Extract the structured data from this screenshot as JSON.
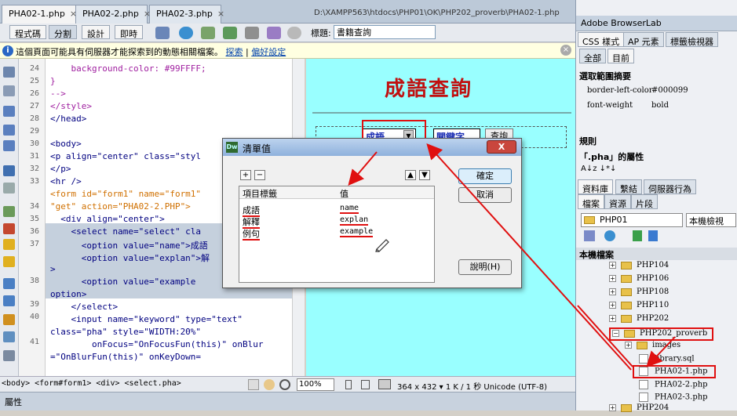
{
  "tabs": [
    {
      "label": "PHA02-1.php",
      "active": true
    },
    {
      "label": "PHA02-2.php",
      "active": false
    },
    {
      "label": "PHA02-3.php",
      "active": false
    }
  ],
  "tab_close": "×",
  "doc_path": "D:\\XAMPP563\\htdocs\\PHP01\\OK\\PHP202_proverb\\PHA02-1.php",
  "toolbar": {
    "views": [
      {
        "label": "程式碼",
        "active": false
      },
      {
        "label": "分割",
        "active": true
      },
      {
        "label": "設計",
        "active": false
      },
      {
        "label": "即時",
        "active": false
      }
    ],
    "title_label": "標題:",
    "title_value": "書籍查詢"
  },
  "infobar": {
    "text": "這個頁面可能具有伺服器才能探索到的動態相關檔案。",
    "link1": "探索",
    "sep": "|",
    "link2": "偏好設定",
    "icon": "i",
    "close": "×"
  },
  "code": {
    "line_numbers": [
      "24",
      "25",
      "26",
      "27",
      "28",
      "29",
      "30",
      "31",
      "32",
      "33",
      "34",
      "35",
      "36",
      "37",
      "",
      "38",
      "",
      "39",
      "40",
      "",
      "41",
      "",
      ""
    ],
    "lines": [
      "    background-color: #99FFFF;",
      "}",
      "-->",
      "</style>",
      "</head>",
      "",
      "<body>",
      "<p align=\"center\" class=\"styl",
      "</p>",
      "<hr />",
      "<form id=\"form1\" name=\"form1\"",
      "\"get\" action=\"PHA02-2.PHP\">",
      "  <div align=\"center\">",
      "    <select name=\"select\" cla",
      "      <option value=\"name\">成語",
      "      <option value=\"explan\">解",
      ">",
      "      <option value=\"example",
      "option>",
      "    </select>",
      "    <input name=\"keyword\" type=\"text\"",
      "class=\"pha\" style=\"WIDTH:20%\"",
      "        onFocus=\"OnFocusFun(this)\" onBlur",
      "=\"OnBlurFun(this)\" onKeyDown="
    ]
  },
  "design": {
    "heading": "成語查詢",
    "select_value": "成語",
    "keyword_value": "關鍵字",
    "query_label": "查詢"
  },
  "statusbar": {
    "tag_path": "<body> <form#form1> <div> <select.pha>",
    "zoom": "100%",
    "info": "364 x 432 ▾ 1 K / 1 秒  Unicode (UTF-8)"
  },
  "properties": {
    "label": "屬性"
  },
  "right": {
    "browserlab": "Adobe BrowserLab",
    "css_tabs": [
      "CSS 樣式",
      "AP 元素",
      "標籤檢視器"
    ],
    "css_subtabs": [
      "全部",
      "目前"
    ],
    "summary_title": "選取範圍摘要",
    "props": [
      {
        "name": "border-left-color",
        "value": "#000099"
      },
      {
        "name": "font-weight",
        "value": "bold"
      }
    ],
    "rules_title": "規則",
    "attr_title": "「.pha」的屬性",
    "attr_tools": "A↓z ↓*↓",
    "files_tabs": [
      "資料庫",
      "繫結",
      "伺服器行為"
    ],
    "files_subtabs": [
      "檔案",
      "資源",
      "片段"
    ],
    "site": "PHP01",
    "view": "本機檢視",
    "local_files": "本機檔案",
    "tree": [
      {
        "label": "PHP104",
        "type": "folder",
        "depth": 1
      },
      {
        "label": "PHP106",
        "type": "folder",
        "depth": 1
      },
      {
        "label": "PHP108",
        "type": "folder",
        "depth": 1
      },
      {
        "label": "PHP110",
        "type": "folder",
        "depth": 1
      },
      {
        "label": "PHP202",
        "type": "folder",
        "depth": 1
      },
      {
        "label": "PHP202_proverb",
        "type": "folder",
        "depth": 1
      },
      {
        "label": "images",
        "type": "folder",
        "depth": 2
      },
      {
        "label": "library.sql",
        "type": "file",
        "depth": 2
      },
      {
        "label": "PHA02-1.php",
        "type": "file",
        "depth": 2
      },
      {
        "label": "PHA02-2.php",
        "type": "file",
        "depth": 2
      },
      {
        "label": "PHA02-3.php",
        "type": "file",
        "depth": 2
      },
      {
        "label": "PHP204",
        "type": "folder",
        "depth": 1
      }
    ]
  },
  "dialog": {
    "icon": "Dw",
    "title": "清單值",
    "close": "X",
    "add": "+",
    "remove": "−",
    "up": "▲",
    "down": "▼",
    "col_label": "項目標籤",
    "col_value": "值",
    "rows": [
      {
        "label": "成語",
        "value": "name"
      },
      {
        "label": "解釋",
        "value": "explan"
      },
      {
        "label": "例句",
        "value": "example"
      }
    ],
    "ok": "確定",
    "cancel": "取消",
    "help": "說明(H)"
  },
  "colors": {
    "design_bg": "#99FFFF",
    "heading": "#C01010",
    "annotation": "#E01010"
  }
}
